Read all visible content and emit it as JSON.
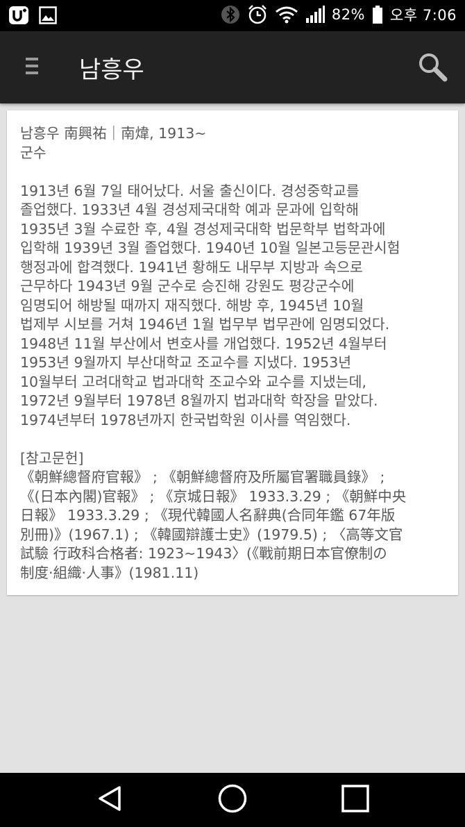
{
  "status_bar": {
    "battery_percent": "82%",
    "clock": "오후 7:06",
    "icons": [
      "u-plus-icon",
      "image-icon",
      "bluetooth-icon",
      "alarm-icon",
      "wifi-icon",
      "signal-icon",
      "battery-icon"
    ]
  },
  "app_bar": {
    "title": "남흥우",
    "menu_icon": "menu-icon",
    "search_icon": "search-icon"
  },
  "article": {
    "heading_line1": "남흥우 南興祐｜南煒, 1913~",
    "heading_line2": "군수",
    "body": "1913년 6월 7일 태어났다. 서울 출신이다. 경성중학교를\n졸업했다. 1933년 4월 경성제국대학 예과 문과에 입학해\n1935년 3월 수료한 후, 4월 경성제국대학 법문학부 법학과에\n입학해 1939년 3월 졸업했다. 1940년 10월 일본고등문관시험\n행정과에 합격했다. 1941년 황해도 내무부 지방과 속으로\n근무하다 1943년 9월 군수로 승진해 강원도 평강군수에\n임명되어 해방될 때까지 재직했다. 해방 후, 1945년 10월\n법제부 시보를 거쳐 1946년 1월 법무부 법무관에 임명되었다.\n1948년 11월 부산에서 변호사를 개업했다. 1952년 4월부터\n1953년 9월까지 부산대학교 조교수를 지냈다. 1953년\n10월부터 고려대학교 법과대학 조교수와 교수를 지냈는데,\n1972년 9월부터 1978년 8월까지 법과대학 학장을 맡았다.\n1974년부터 1978년까지 한국법학원 이사를 역임했다.",
    "references_heading": "[참고문헌]",
    "references": "《朝鮮總督府官報》 ; 《朝鮮總督府及所屬官署職員錄》 ;\n《(日本內閣)官報》 ; 《京城日報》 1933.3.29 ; 《朝鮮中央\n日報》 1933.3.29 ; 《現代韓國人名辭典(合同年鑑 67年版\n別冊)》(1967.1) ; 《韓國辯護士史》(1979.5) ; 〈高等文官\n試驗 行政科合格者: 1923~1943〉(《戰前期日本官僚制の\n制度·組織·人事》(1981.11)"
  },
  "nav_bar": {
    "icons": [
      "back-icon",
      "home-icon",
      "recents-icon"
    ]
  }
}
